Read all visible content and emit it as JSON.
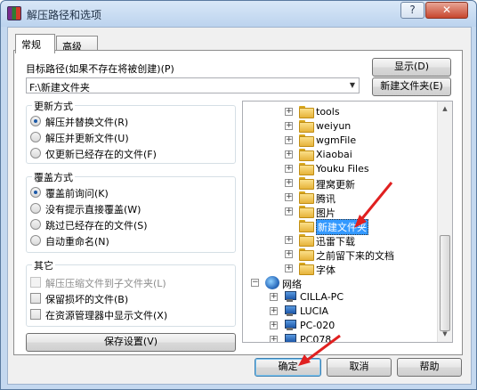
{
  "window": {
    "title": "解压路径和选项",
    "help_button": "?",
    "close_button": "✕"
  },
  "tabs": [
    {
      "label": "常规",
      "active": true
    },
    {
      "label": "高级",
      "active": false
    }
  ],
  "target_path": {
    "label": "目标路径(如果不存在将被创建)(P)",
    "value": "F:\\新建文件夹",
    "dropdown_glyph": "▼"
  },
  "buttons": {
    "show": "显示(D)",
    "new_folder": "新建文件夹(E)",
    "save_settings": "保存设置(V)",
    "ok": "确定",
    "cancel": "取消",
    "help": "帮助"
  },
  "update_mode": {
    "title": "更新方式",
    "options": [
      {
        "label": "解压并替换文件(R)",
        "selected": true
      },
      {
        "label": "解压并更新文件(U)",
        "selected": false
      },
      {
        "label": "仅更新已经存在的文件(F)",
        "selected": false
      }
    ]
  },
  "overwrite_mode": {
    "title": "覆盖方式",
    "options": [
      {
        "label": "覆盖前询问(K)",
        "selected": true
      },
      {
        "label": "没有提示直接覆盖(W)",
        "selected": false
      },
      {
        "label": "跳过已经存在的文件(S)",
        "selected": false
      },
      {
        "label": "自动重命名(N)",
        "selected": false
      }
    ]
  },
  "misc": {
    "title": "其它",
    "options": [
      {
        "label": "解压压缩文件到子文件夹(L)",
        "checked": false,
        "disabled": true
      },
      {
        "label": "保留损坏的文件(B)",
        "checked": false,
        "disabled": false
      },
      {
        "label": "在资源管理器中显示文件(X)",
        "checked": false,
        "disabled": false
      }
    ]
  },
  "tree": {
    "folders": [
      "tools",
      "weiyun",
      "wgmFile",
      "Xiaobai",
      "Youku Files",
      "狸窝更新",
      "腾讯",
      "图片",
      "新建文件夹",
      "迅雷下载",
      "之前留下来的文档",
      "字体"
    ],
    "selected": "新建文件夹",
    "network_label": "网络",
    "computers": [
      "CILLA-PC",
      "LUCIA",
      "PC-020",
      "PC078"
    ]
  },
  "annotation_color": "#e02020",
  "scrollbar": {
    "up_glyph": "▲",
    "down_glyph": "▼"
  }
}
